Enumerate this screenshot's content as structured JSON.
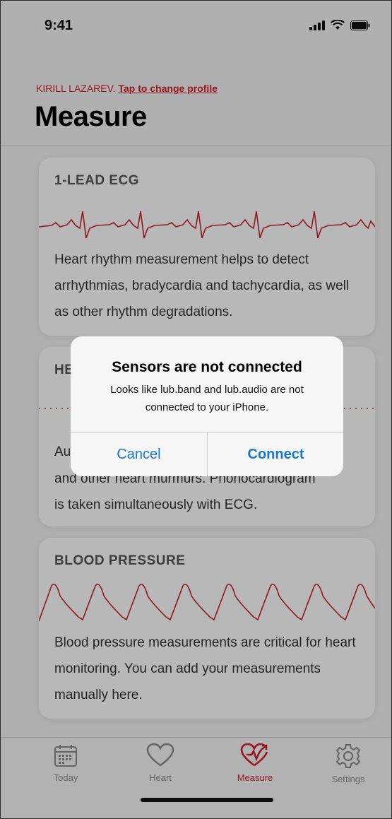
{
  "status_bar": {
    "time": "9:41"
  },
  "header": {
    "profile_name": "KIRILL LAZAREV.",
    "profile_link": "Tap to change profile",
    "title": "Measure"
  },
  "cards": [
    {
      "title": "1-LEAD ECG",
      "description": "Heart rhythm measurement helps to detect arrhythmias, bradycardia and tachycardia, as well as other rhythm degradations."
    },
    {
      "title_visible": "HE",
      "description_line1_visible": "Au",
      "description_line2": "and other heart murmurs. Phonocardiogram",
      "description_line3": "is taken simultaneously with ECG."
    },
    {
      "title": "BLOOD PRESSURE",
      "description": "Blood pressure measurements are critical for heart monitoring. You can add your measurements manually here."
    }
  ],
  "alert": {
    "title": "Sensors are not connected",
    "message": "Looks like lub.band and lub.audio are not connected to your iPhone.",
    "cancel_label": "Cancel",
    "connect_label": "Connect"
  },
  "tabs": [
    {
      "label": "Today",
      "icon": "calendar-icon",
      "active": false
    },
    {
      "label": "Heart",
      "icon": "heart-icon",
      "active": false
    },
    {
      "label": "Measure",
      "icon": "heart-pulse-icon",
      "active": true
    },
    {
      "label": "Settings",
      "icon": "gear-icon",
      "active": false
    }
  ],
  "colors": {
    "accent_red": "#d11f2b",
    "ios_blue": "#1478d4"
  }
}
